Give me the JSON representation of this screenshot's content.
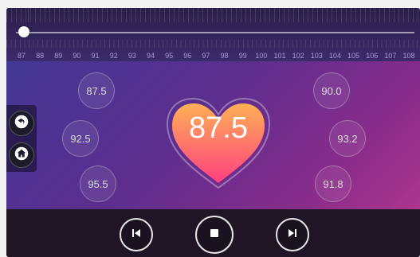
{
  "tuner": {
    "scale_labels": [
      "87",
      "88",
      "89",
      "90",
      "91",
      "92",
      "93",
      "94",
      "95",
      "96",
      "97",
      "98",
      "99",
      "100",
      "101",
      "102",
      "103",
      "104",
      "105",
      "106",
      "107",
      "108"
    ],
    "current_frequency": "87.5",
    "tuning_fraction": 0.02
  },
  "presets": {
    "left": [
      "87.5",
      "92.5",
      "95.5"
    ],
    "right": [
      "90.0",
      "93.2",
      "91.8"
    ]
  },
  "colors": {
    "heart_top": "#ffb055",
    "heart_bottom": "#ff4080",
    "background_start": "#3d3a96",
    "background_end": "#b93a8e"
  },
  "icons": {
    "back": "back-arrow-icon",
    "home": "home-icon",
    "prev": "skip-previous-icon",
    "stop": "stop-icon",
    "next": "skip-next-icon"
  }
}
